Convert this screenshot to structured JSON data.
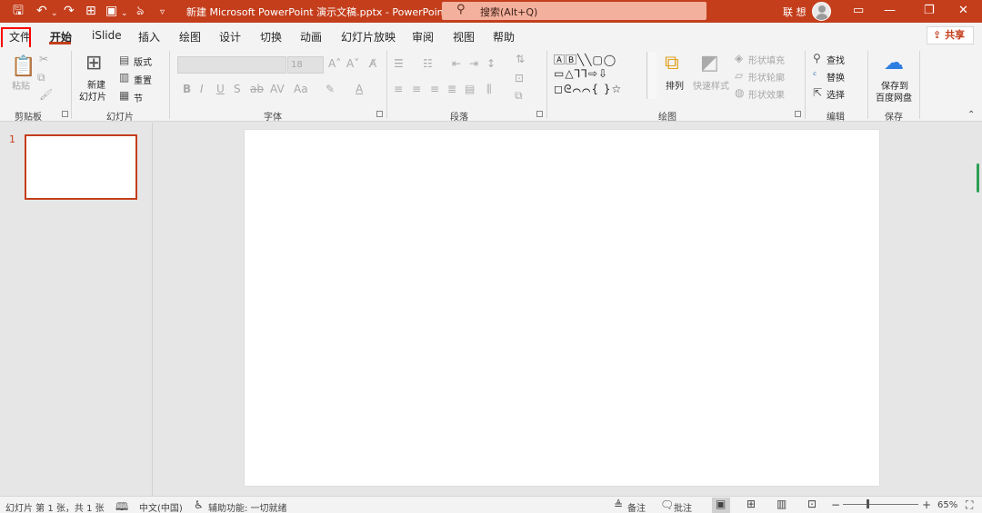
{
  "window": {
    "title": "新建 Microsoft PowerPoint 演示文稿.pptx  -  PowerPoint",
    "user": "联 想",
    "search_placeholder": "搜索(Alt+Q)",
    "accent": "#c43e1c"
  },
  "tabs": [
    "文件",
    "开始",
    "iSlide",
    "插入",
    "绘图",
    "设计",
    "切换",
    "动画",
    "幻灯片放映",
    "审阅",
    "视图",
    "帮助"
  ],
  "active_tab": "开始",
  "share_label": "共享",
  "ribbon": {
    "clipboard": {
      "paste": "粘贴",
      "group": "剪贴板"
    },
    "slides": {
      "new_line1": "新建",
      "new_line2": "幻灯片",
      "layout": "版式",
      "reset": "重置",
      "section": "节",
      "group": "幻灯片"
    },
    "font": {
      "size": "18",
      "group": "字体"
    },
    "paragraph": {
      "group": "段落"
    },
    "drawing": {
      "arrange": "排列",
      "quick_styles": "快速样式",
      "shape_fill": "形状填充",
      "shape_outline": "形状轮廓",
      "shape_effects": "形状效果",
      "group": "绘图"
    },
    "editing": {
      "find": "查找",
      "replace": "替换",
      "select": "选择",
      "group": "编辑"
    },
    "save": {
      "line1": "保存到",
      "line2": "百度网盘",
      "group": "保存"
    }
  },
  "slides_pane": {
    "slide_number": "1"
  },
  "status": {
    "slide_info": "幻灯片 第 1 张，共 1 张",
    "language": "中文(中国)",
    "accessibility": "辅助功能: 一切就绪",
    "notes": "备注",
    "comments": "批注",
    "zoom": "65%",
    "zoom_level": 0.65
  }
}
